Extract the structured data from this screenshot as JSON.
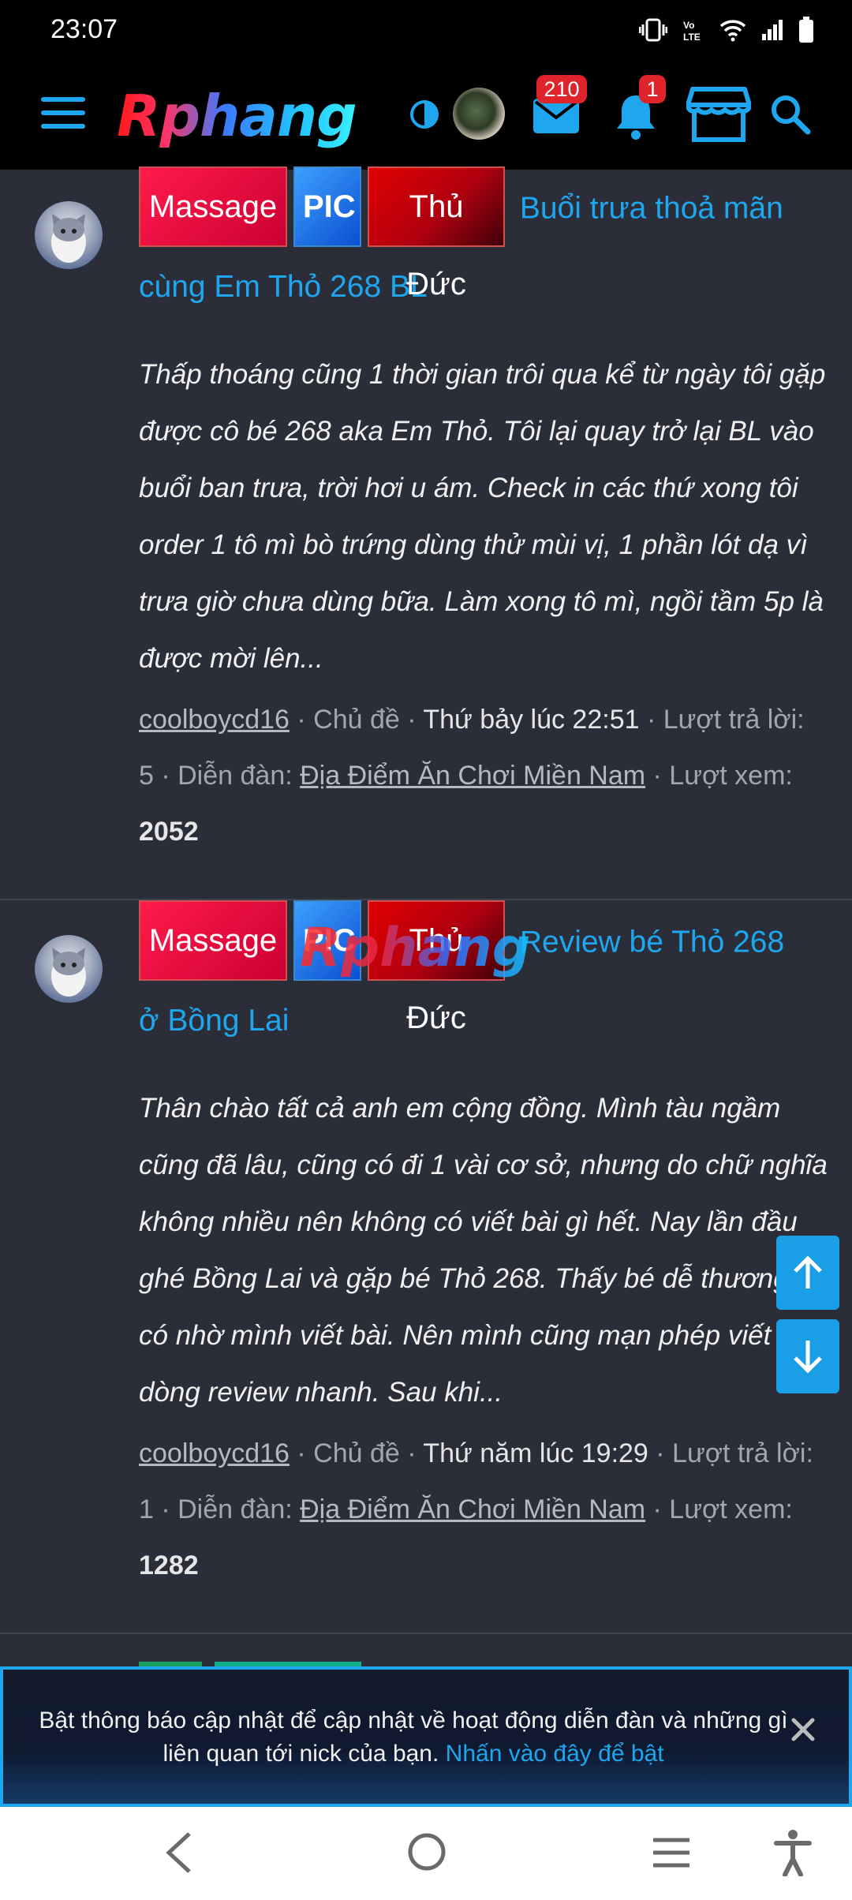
{
  "status_bar": {
    "time": "23:07"
  },
  "app_bar": {
    "logo_text": "Rphang",
    "mail_badge": "210",
    "bell_badge": "1"
  },
  "threads": [
    {
      "tags": [
        "Massage",
        "PIC",
        "Thủ Đức"
      ],
      "title_part1": "Buổi trưa thoả mãn",
      "title_part2": "cùng Em Thỏ 268 BL",
      "excerpt": "Thấp thoáng cũng 1 thời gian trôi qua kể từ ngày tôi gặp được cô bé 268 aka Em Thỏ. Tôi lại quay trở lại BL vào buổi ban trưa, trời hơi u ám. Check in các thứ xong tôi order 1 tô mì bò trứng dùng thử mùi vị, 1 phần lót dạ vì trưa giờ chưa dùng bữa. Làm xong tô mì, ngồi tầm 5p là được mời lên...",
      "author": "coolboycd16",
      "sep1": " · Chủ đề · ",
      "date": "Thứ bảy lúc 22:51",
      "replies_text": " · Lượt trả lời: 5 · Diễn đàn: ",
      "forum": "Địa Điểm Ăn Chơi Miền Nam",
      "views_label": " · Lượt xem: ",
      "views": "2052"
    },
    {
      "tags": [
        "Massage",
        "PIC",
        "Thủ Đức"
      ],
      "title_part1": "Review bé Thỏ 268",
      "title_part2": "ở Bồng Lai",
      "excerpt": "Thân chào tất cả anh em cộng đồng. Mình tàu ngầm cũng đã lâu, cũng có đi 1 vài cơ sở, nhưng do chữ nghĩa không nhiều nên không có viết bài gì hết. Nay lần đầu ghé Bồng Lai và gặp bé Thỏ 268. Thấy bé dễ thương và có nhờ mình viết bài. Nên mình cũng mạn phép viết vài dòng review nhanh. Sau khi...",
      "author": "coolboycd16",
      "sep1": " · Chủ đề · ",
      "date": "Thứ năm lúc 19:29",
      "replies_text": " · Lượt trả lời: 1 · Diễn đàn: ",
      "forum": "Địa Điểm Ăn Chơi Miền Nam",
      "views_label": " · Lượt xem: ",
      "views": "1282"
    }
  ],
  "watermark_text": "Rphang",
  "notice": {
    "text": "Bật thông báo cập nhật để cập nhật về hoạt động diễn đàn và những gì liên quan tới nick của bạn. ",
    "link": "Nhấn vào đây để bật"
  },
  "colors": {
    "accent": "#1ea7ee",
    "background": "#2b2e39",
    "badge": "#e0242b"
  },
  "icons": [
    "hamburger-menu-icon",
    "theme-toggle-icon",
    "mail-icon",
    "bell-icon",
    "store-icon",
    "search-icon",
    "arrow-up-icon",
    "arrow-down-icon",
    "close-icon",
    "nav-back-icon",
    "nav-home-icon",
    "nav-recent-icon",
    "accessibility-icon"
  ]
}
